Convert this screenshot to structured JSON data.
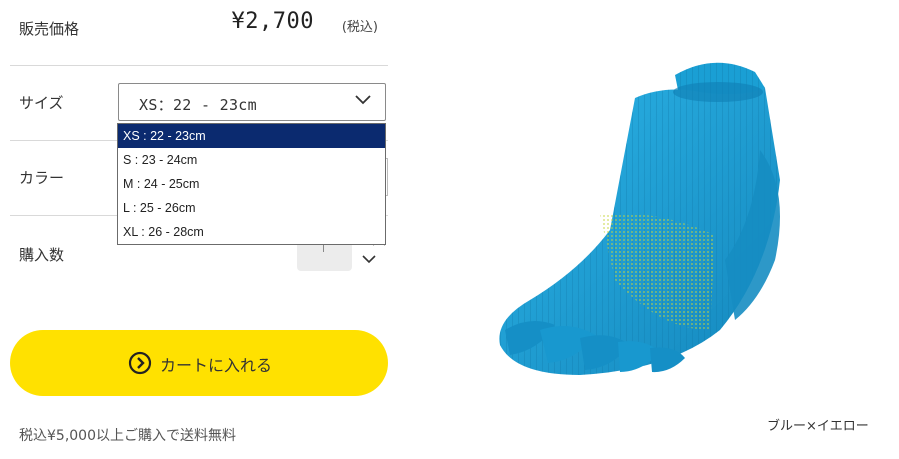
{
  "price": {
    "label": "販売価格",
    "value": "¥2,700",
    "tax_note": "(税込)"
  },
  "size": {
    "label": "サイズ",
    "selected": "XS：22 - 23cm",
    "options": [
      "XS : 22 - 23cm",
      "S : 23 - 24cm",
      "M : 24 - 25cm",
      "L : 25 - 26cm",
      "XL : 26 - 28cm"
    ]
  },
  "color": {
    "label": "カラー"
  },
  "quantity": {
    "label": "購入数"
  },
  "cart_button": {
    "label": "カートに入れる"
  },
  "shipping_note": "税込¥5,000以上ご購入で送料無料",
  "product": {
    "caption": "ブルー×イエロー"
  },
  "colors": {
    "accent_yellow": "#ffe100",
    "dropdown_selected": "#0b2a6f",
    "sock_blue": "#1a9fd4",
    "sock_yellow_accent": "#c8d43a"
  }
}
